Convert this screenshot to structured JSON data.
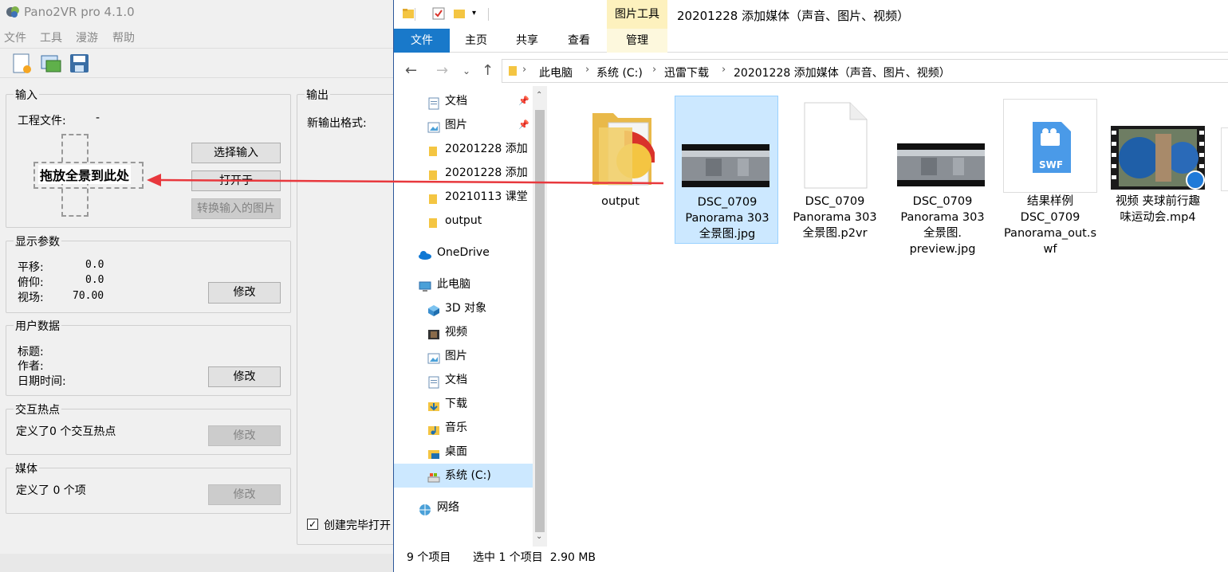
{
  "pano": {
    "title": "Pano2VR pro 4.1.0",
    "menu": [
      "文件",
      "工具",
      "漫游",
      "帮助"
    ],
    "toolbar_icons": [
      "new-project-icon",
      "open-project-icon",
      "save-project-icon"
    ],
    "input": {
      "title": "输入",
      "project_label": "工程文件:",
      "project_value": "-",
      "drop_text": "拖放全景到此处",
      "select_btn": "选择输入",
      "open_btn": "打开于",
      "convert_btn": "转换输入的图片"
    },
    "output": {
      "title": "输出",
      "new_format_label": "新输出格式:",
      "open_checkbox_label": "创建完毕打开"
    },
    "display": {
      "title": "显示参数",
      "pan_label": "平移:",
      "pan_value": "0.0",
      "tilt_label": "俯仰:",
      "tilt_value": "0.0",
      "fov_label": "视场:",
      "fov_value": "70.00",
      "modify_btn": "修改"
    },
    "user_data": {
      "title": "用户数据",
      "title_label": "标题:",
      "author_label": "作者:",
      "date_label": "日期时间:",
      "modify_btn": "修改"
    },
    "hotspots": {
      "title": "交互热点",
      "desc": "定义了0 个交互热点",
      "modify_btn": "修改"
    },
    "media": {
      "title": "媒体",
      "desc": "定义了 0 个项",
      "modify_btn": "修改"
    }
  },
  "explorer": {
    "title": "20201228 添加媒体（声音、图片、视频）",
    "context_tab": "图片工具",
    "ribbon_tabs": [
      "文件",
      "主页",
      "共享",
      "查看",
      "管理"
    ],
    "breadcrumb": [
      "此电脑",
      "系统 (C:)",
      "迅雷下载",
      "20201228 添加媒体（声音、图片、视频）"
    ],
    "nav_items": [
      {
        "label": "文档",
        "icon": "documents-icon",
        "pinned": true
      },
      {
        "label": "图片",
        "icon": "pictures-icon",
        "pinned": true
      },
      {
        "label": "20201228 添加",
        "icon": "folder-icon",
        "pinned": false
      },
      {
        "label": "20201228 添加",
        "icon": "folder-icon",
        "pinned": false
      },
      {
        "label": "20210113 课堂",
        "icon": "folder-icon",
        "pinned": false
      },
      {
        "label": "output",
        "icon": "folder-icon",
        "pinned": false
      },
      {
        "label": "OneDrive",
        "icon": "onedrive-icon",
        "pinned": false
      },
      {
        "label": "此电脑",
        "icon": "this-pc-icon",
        "pinned": false
      },
      {
        "label": "3D 对象",
        "icon": "3d-objects-icon",
        "pinned": false
      },
      {
        "label": "视频",
        "icon": "videos-icon",
        "pinned": false
      },
      {
        "label": "图片",
        "icon": "pictures-icon",
        "pinned": false
      },
      {
        "label": "文档",
        "icon": "documents-icon",
        "pinned": false
      },
      {
        "label": "下载",
        "icon": "downloads-icon",
        "pinned": false
      },
      {
        "label": "音乐",
        "icon": "music-icon",
        "pinned": false
      },
      {
        "label": "桌面",
        "icon": "desktop-icon",
        "pinned": false
      },
      {
        "label": "系统 (C:)",
        "icon": "drive-icon",
        "pinned": false
      },
      {
        "label": "网络",
        "icon": "network-icon",
        "pinned": false
      }
    ],
    "files": [
      {
        "name": "output",
        "type": "folder"
      },
      {
        "name": "DSC_0709 Panorama 303 全景图.jpg",
        "type": "panorama"
      },
      {
        "name": "DSC_0709 Panorama 303 全景图.p2vr",
        "type": "blank"
      },
      {
        "name": "DSC_0709 Panorama 303 全景图. preview.jpg",
        "type": "panorama"
      },
      {
        "name": "结果样例 DSC_0709 Panorama_out.swf",
        "type": "swf"
      },
      {
        "name": "视频 夹球前行趣味运动会.mp4",
        "type": "video"
      }
    ],
    "file_lines": [
      [
        "output"
      ],
      [
        "DSC_0709",
        "Panorama 303",
        "全景图.jpg"
      ],
      [
        "DSC_0709",
        "Panorama 303",
        "全景图.p2vr"
      ],
      [
        "DSC_0709",
        "Panorama 303",
        "全景图.",
        "preview.jpg"
      ],
      [
        "结果样例",
        "DSC_0709",
        "Panorama_out.s",
        "wf"
      ],
      [
        "视频 夹球前行趣",
        "味运动会.mp4"
      ]
    ],
    "swf_badge": "SWF",
    "status_count": "9 个项目",
    "status_selection": "选中 1 个项目  2.90 MB"
  },
  "colors": {
    "accent_blue": "#1979ca",
    "selection": "#cce8ff",
    "context_tab": "#fdf1be",
    "arrow": "#e8383d"
  }
}
